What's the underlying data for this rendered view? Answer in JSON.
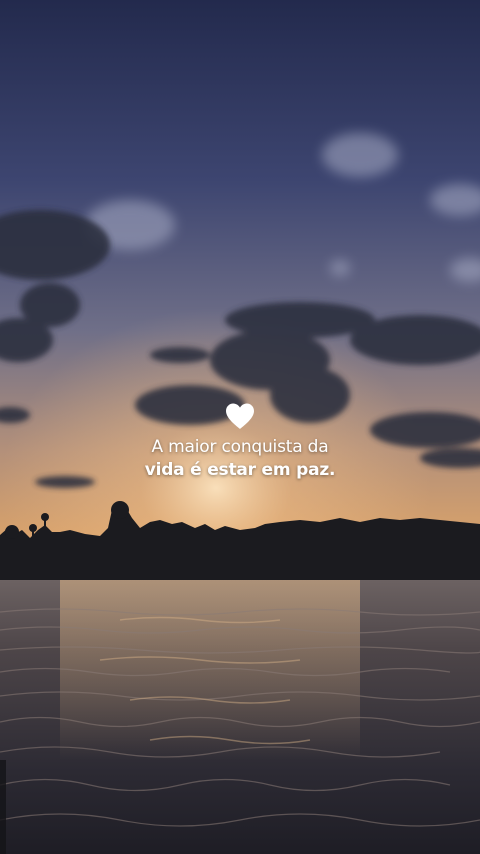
{
  "quote": {
    "icon": "heart-icon",
    "line1": "A maior conquista da",
    "line2": "vida é estar em paz."
  },
  "colors": {
    "sky_top": "#2a3156",
    "sky_mid": "#6e6f8a",
    "horizon_glow": "#d9a26a",
    "water": "#3a3640",
    "text": "#ffffff"
  }
}
